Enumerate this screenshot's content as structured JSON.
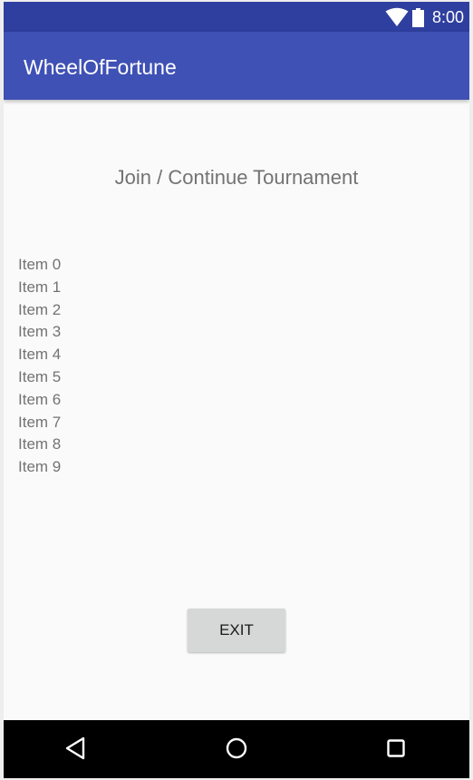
{
  "status_bar": {
    "time": "8:00",
    "icons": [
      "wifi-icon",
      "battery-icon"
    ]
  },
  "app_bar": {
    "title": "WheelOfFortune",
    "color": "#3f51b5",
    "status_color": "#2f3f9f"
  },
  "main": {
    "title": "Join / Continue Tournament",
    "items": [
      "Item 0",
      "Item 1",
      "Item 2",
      "Item 3",
      "Item 4",
      "Item 5",
      "Item 6",
      "Item 7",
      "Item 8",
      "Item 9"
    ],
    "exit_label": "EXIT"
  },
  "nav_bar": {
    "icons": [
      "back-icon",
      "home-icon",
      "recents-icon"
    ]
  }
}
